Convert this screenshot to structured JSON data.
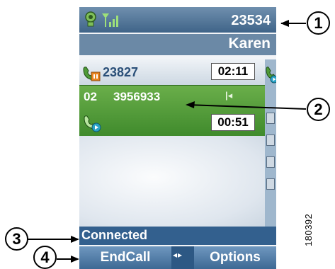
{
  "header": {
    "line_number": "23534",
    "signal_icon": "signal-bars-icon",
    "status_icon": "headset-icon"
  },
  "contact": {
    "name": "Karen"
  },
  "calls": [
    {
      "state": "held",
      "number": "23827",
      "timer": "02:11",
      "icon": "phone-hold-icon"
    },
    {
      "state": "active",
      "line": "02",
      "number": "3956933",
      "timer": "00:51",
      "icon": "phone-active-icon"
    }
  ],
  "status": {
    "text": "Connected"
  },
  "softkeys": {
    "left": "EndCall",
    "right": "Options",
    "nav": "◂▸"
  },
  "callouts": [
    "1",
    "2",
    "3",
    "4"
  ],
  "figure_id": "180392",
  "colors": {
    "header": "#3f6488",
    "active_call": "#4f9a38",
    "softkey": "#3d6994",
    "status_bar": "#33608e"
  }
}
